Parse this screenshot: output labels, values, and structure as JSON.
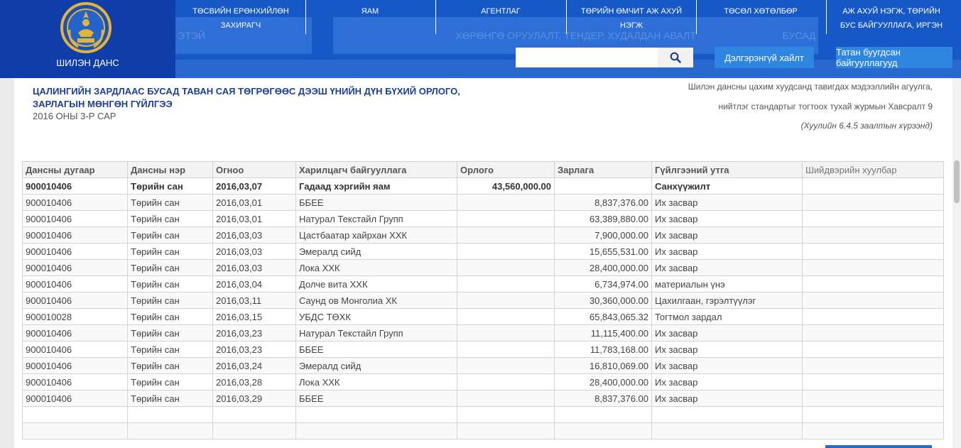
{
  "header": {
    "logo_text": "ШИЛЭН ДАНС",
    "nav": [
      {
        "label": "ТӨСВИЙН ЕРӨНХИЙЛӨН ЗАХИРАГЧ"
      },
      {
        "label": "ЯАМ"
      },
      {
        "label": "АГЕНТЛАГ"
      },
      {
        "label": "ТӨРИЙН ӨМЧИТ АЖ АХУЙ НЭГЖ"
      },
      {
        "label": "ТӨСӨЛ ХӨТӨЛБӨР"
      },
      {
        "label": "АЖ АХУЙ НЭГЖ, ТӨРИЙН БУС БАЙГУУЛЛАГА, ИРГЭН"
      }
    ],
    "ghost_tabs": [
      "ЭТЭЙ",
      "ХӨРӨНГӨ ОРУУЛАЛТ, ТЕНДЕР, ХУДАЛДАН АВАЛТ",
      "БУСАД"
    ],
    "search_placeholder": "",
    "advanced_search_label": "Дэлгэрэнгүй хайлт",
    "download_label": "Татан буугдсан байгууллагууд"
  },
  "report": {
    "title": "ЦАЛИНГИЙН ЗАРДЛААС БУСАД ТАВАН САЯ ТӨГРӨГӨӨС ДЭЭШ ҮНИЙН ДҮН БҮХИЙ ОРЛОГО, ЗАРЛАГЫН МӨНГӨН ГҮЙЛГЭЭ",
    "period": "2016 ОНЫ 3-Р САР",
    "note_line1": "Шилэн дансны цахим хуудсанд тавигдах мэдээллийн агуулга,",
    "note_line2": "нийтлэг стандартыг тогтоох тухай журмын Хавсралт 9",
    "note_line3": "(Хуулийн 6.4.5 заалтын хүрээнд)"
  },
  "table": {
    "headers": [
      "Дансны дугаар",
      "Дансны нэр",
      "Огноо",
      "Харилцагч байгууллага",
      "Орлого",
      "Зарлага",
      "Гүйлгээний утга",
      "Шийдвэрийн хуулбар"
    ],
    "rows": [
      [
        "900010406",
        "Төрийн сан",
        "2016,03,07",
        "Гадаад хэргийн яам",
        "43,560,000.00",
        "",
        "Санхүүжилт",
        ""
      ],
      [
        "900010406",
        "Төрийн сан",
        "2016,03,01",
        "ББЕЕ",
        "",
        "8,837,376.00",
        "Их засвар",
        ""
      ],
      [
        "900010406",
        "Төрийн сан",
        "2016,03,01",
        "Натурал Текстайл Групп",
        "",
        "63,389,880.00",
        "Их засвар",
        ""
      ],
      [
        "900010406",
        "Төрийн сан",
        "2016,03,03",
        "Цастбаатар хайрхан ХХК",
        "",
        "7,900,000.00",
        "Их засвар",
        ""
      ],
      [
        "900010406",
        "Төрийн сан",
        "2016,03,03",
        "Эмералд сийд",
        "",
        "15,655,531.00",
        "Их засвар",
        ""
      ],
      [
        "900010406",
        "Төрийн сан",
        "2016,03,03",
        "Лока ХХК",
        "",
        "28,400,000.00",
        "Их засвар",
        ""
      ],
      [
        "900010406",
        "Төрийн сан",
        "2016,03,04",
        "Долче вита ХХК",
        "",
        "6,734,974.00",
        "материалын үнэ",
        ""
      ],
      [
        "900010406",
        "Төрийн сан",
        "2016,03,11",
        "Саунд ов Монголиа ХК",
        "",
        "30,360,000.00",
        "Цахилгаан, гэрэлтүүлэг",
        ""
      ],
      [
        "900010028",
        "Төрийн сан",
        "2016,03,15",
        "УБДС ТӨХК",
        "",
        "65,843,065.32",
        "Тогтмол зардал",
        ""
      ],
      [
        "900010406",
        "Төрийн сан",
        "2016,03,23",
        "Натурал Текстайл Групп",
        "",
        "11,115,400.00",
        "Их засвар",
        ""
      ],
      [
        "900010406",
        "Төрийн сан",
        "2016,03,23",
        "ББЕЕ",
        "",
        "11,783,168.00",
        "Их засвар",
        ""
      ],
      [
        "900010406",
        "Төрийн сан",
        "2016,03,24",
        "Эмералд сийд",
        "",
        "16,810,069.00",
        "Их засвар",
        ""
      ],
      [
        "900010406",
        "Төрийн сан",
        "2016,03,28",
        "Лока ХХК",
        "",
        "28,400,000.00",
        "Их засвар",
        ""
      ],
      [
        "900010406",
        "Төрийн сан",
        "2016,03,29",
        "ББЕЕ",
        "",
        "8,837,376.00",
        "Их засвар",
        ""
      ],
      [
        "",
        "",
        "",
        "",
        "",
        "",
        "",
        ""
      ],
      [
        "",
        "",
        "",
        "",
        "",
        "",
        "",
        ""
      ]
    ]
  },
  "colors": {
    "header_blue": "#1659c6",
    "logo_blue": "#0f3ea8",
    "button_blue": "#2e86e0",
    "title_blue": "#1c3f94"
  },
  "icons": {
    "search": "search-icon",
    "emblem": "state-emblem-icon"
  }
}
